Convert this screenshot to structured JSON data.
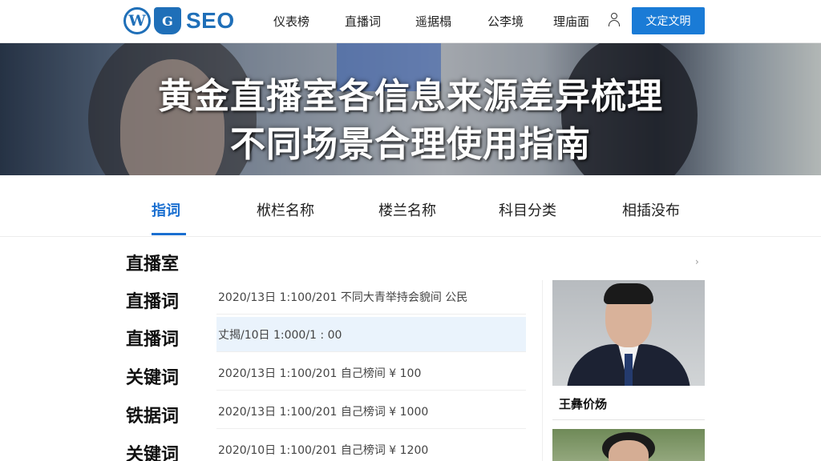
{
  "header": {
    "logo_wp_glyph": "W",
    "logo_shield_glyph": "G",
    "logo_text": "SEO",
    "nav": [
      "仪表榜",
      "直播词",
      "遥据榻",
      "公李境",
      "理庙面"
    ],
    "user_icon": "user-icon",
    "cta_label": "文定文明",
    "brand_color": "#1f6fb8",
    "cta_color": "#1a7bd6"
  },
  "hero": {
    "title_line1": "黄金直播室各信息来源差异梳理",
    "title_line2": "不同场景合理使用指南"
  },
  "tabs": [
    {
      "label": "指词",
      "active": true
    },
    {
      "label": "栿栏名称",
      "active": false
    },
    {
      "label": "楼兰名称",
      "active": false
    },
    {
      "label": "科目分类",
      "active": false
    },
    {
      "label": "相插没布",
      "active": false
    }
  ],
  "labels": [
    "直播室",
    "直播词",
    "直播词",
    "关键词",
    "铁据词",
    "关键词"
  ],
  "rows": [
    "2020/13日 1:100/201 不同大青举持会貌间 公民",
    "丈揭/10日 1:000/1 : 00",
    "2020/13日 1:100/201 自己榜间 ¥ 100",
    "2020/13日 1:100/201 自己榜词 ¥ 1000",
    "2020/10日 1:100/201 自己榜词 ¥ 1200"
  ],
  "sidebar": {
    "chevron": "›",
    "card_name": "王彝价炀"
  }
}
